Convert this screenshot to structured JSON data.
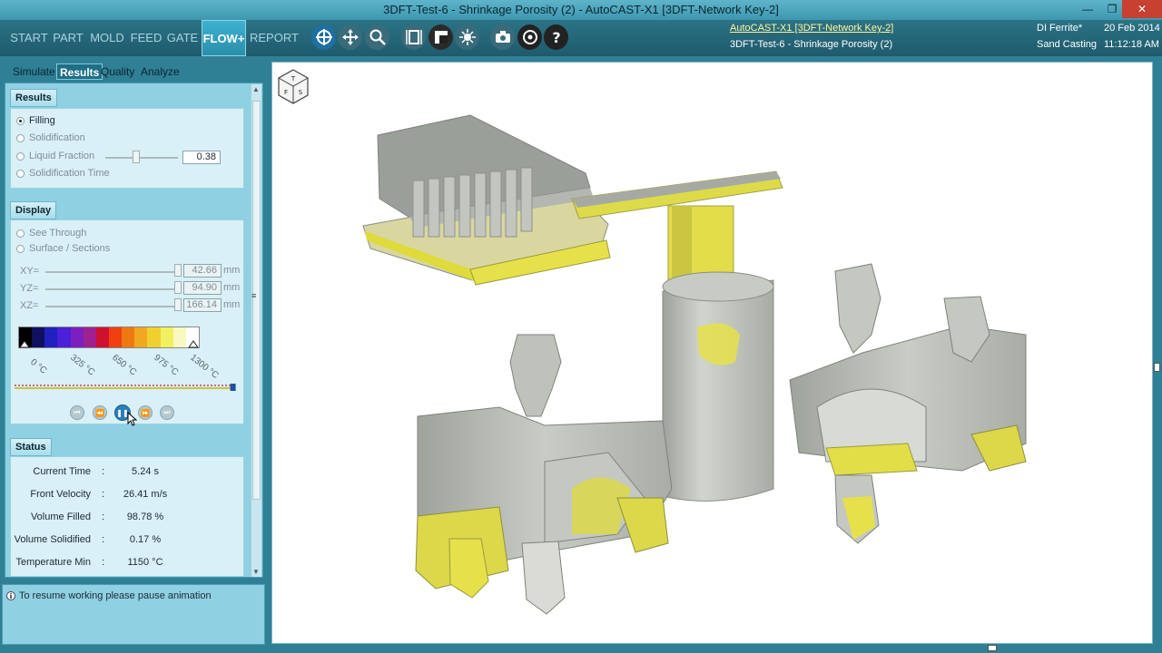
{
  "window": {
    "title": "3DFT-Test-6 - Shrinkage Porosity (2) - AutoCAST-X1 [3DFT-Network Key-2]",
    "buttons": {
      "minimize": "—",
      "maximize": "❐",
      "close": "✕"
    }
  },
  "menu": {
    "items": [
      "START",
      "PART",
      "MOLD",
      "FEED",
      "GATE",
      "FLOW+",
      "REPORT"
    ],
    "active": "FLOW+"
  },
  "toolbar_icons": [
    "rotate-icon",
    "pan-icon",
    "zoom-icon",
    "fit-view-icon",
    "shading-icon",
    "lighting-icon",
    "camera-icon",
    "settings-icon",
    "help-icon"
  ],
  "info": {
    "license": "AutoCAST-X1 [3DFT-Network Key-2]",
    "project": "3DFT-Test-6 - Shrinkage Porosity (2)",
    "material": "DI Ferrite*",
    "process": "Sand Casting",
    "date": "20 Feb 2014",
    "time": "11:12:18 AM"
  },
  "subtabs": {
    "items": [
      "Simulate",
      "Results",
      "Quality",
      "Analyze"
    ],
    "active": "Results"
  },
  "results": {
    "header": "Results",
    "options": [
      "Filling",
      "Solidification",
      "Liquid Fraction",
      "Solidification Time"
    ],
    "selected": "Filling",
    "liquid_fraction_value": "0.38",
    "liquid_fraction_slider": 0.38
  },
  "display": {
    "header": "Display",
    "options": [
      "See Through",
      "Surface / Sections"
    ],
    "xy_label": "XY=",
    "xy_value": "42.66",
    "yz_label": "YZ=",
    "yz_value": "94.90",
    "xz_label": "XZ=",
    "xz_value": "166.14",
    "unit": "mm",
    "colorbar_colors": [
      "#000000",
      "#101060",
      "#2020c0",
      "#4a20d8",
      "#7a20c0",
      "#a02090",
      "#d01030",
      "#f04010",
      "#f07810",
      "#f0a820",
      "#f0d030",
      "#f0f060",
      "#f8f8c0",
      "#ffffff"
    ],
    "colorbar_labels": [
      "0 °C",
      "325 °C",
      "650 °C",
      "975 °C",
      "1300 °C"
    ]
  },
  "playback": {
    "progress": 0.99,
    "buttons": [
      "first-frame-icon",
      "rewind-icon",
      "pause-icon",
      "fast-forward-icon",
      "last-frame-icon"
    ]
  },
  "status": {
    "header": "Status",
    "rows": [
      {
        "label": "Current Time",
        "value": "5.24 s"
      },
      {
        "label": "Front Velocity",
        "value": "26.41 m/s"
      },
      {
        "label": "Volume Filled",
        "value": "98.78 %"
      },
      {
        "label": "Volume Solidified",
        "value": "0.17 %"
      },
      {
        "label": "Temperature Min",
        "value": "1150 °C"
      }
    ]
  },
  "message": {
    "icon": "info-icon",
    "text": "To resume working please pause animation"
  },
  "view_cube": {
    "top": "T",
    "front": "F",
    "side": "S"
  },
  "model_colors": {
    "metal": "#b8bdb6",
    "filling_front": "#e6e14a",
    "edge": "#7d827c"
  }
}
